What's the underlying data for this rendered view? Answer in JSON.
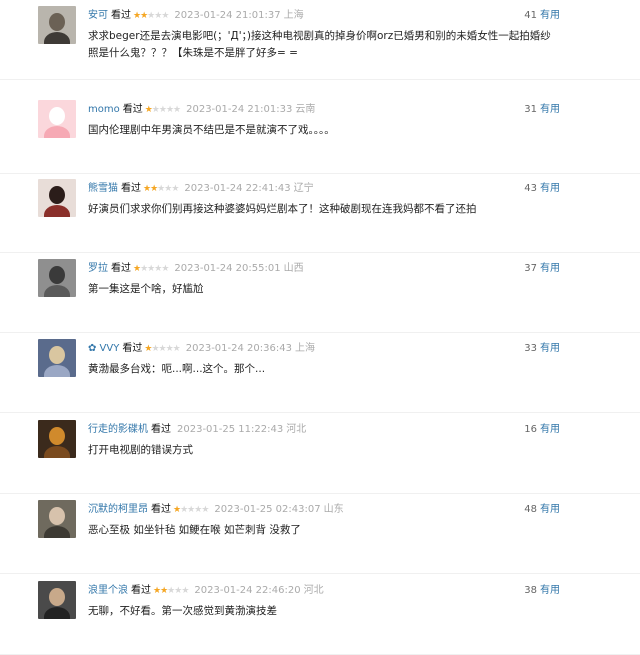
{
  "accent_colors": {
    "link": "#3377aa",
    "star_on": "#f5a623",
    "star_off": "#d8d8d8"
  },
  "reviews": [
    {
      "user": "安可",
      "status": "看过",
      "rating": 2,
      "time": "2023-01-24 21:01:37",
      "location": "上海",
      "useful_count": "41",
      "useful_label": "有用",
      "content": "求求beger还是去演电影吧(；'Д'；)接这种电视剧真的掉身价啊orz已婚男和别的未婚女性一起拍婚纱照是什么鬼？？？【朱珠是不是胖了好多= =",
      "avatar_colors": {
        "bg": "#b9b5ad",
        "head": "#6b6155",
        "body": "#3e3a36"
      }
    },
    {
      "user": "momo",
      "status": "看过",
      "rating": 1,
      "time": "2023-01-24 21:01:33",
      "location": "云南",
      "useful_count": "31",
      "useful_label": "有用",
      "content": "国内伦理剧中年男演员不结巴是不是就演不了戏。。。。",
      "avatar_colors": {
        "bg": "#fbd7dc",
        "head": "#ffffff",
        "body": "#f6a9b4"
      }
    },
    {
      "user": "熊雪猫",
      "status": "看过",
      "rating": 2,
      "time": "2023-01-24 22:41:43",
      "location": "辽宁",
      "useful_count": "43",
      "useful_label": "有用",
      "content": "好演员们求求你们别再接这种婆婆妈妈烂剧本了！这种破剧现在连我妈都不看了还拍",
      "avatar_colors": {
        "bg": "#e8ddd8",
        "head": "#2b1d1a",
        "body": "#8a2f2a"
      }
    },
    {
      "user": "罗拉",
      "status": "看过",
      "rating": 1,
      "time": "2023-01-24 20:55:01",
      "location": "山西",
      "useful_count": "37",
      "useful_label": "有用",
      "content": "第一集这是个啥，好尴尬",
      "avatar_colors": {
        "bg": "#8f8f8f",
        "head": "#3a3a3a",
        "body": "#5a5a5a"
      }
    },
    {
      "user": "✿ VVY",
      "status": "看过",
      "rating": 1,
      "time": "2023-01-24 20:36:43",
      "location": "上海",
      "useful_count": "33",
      "useful_label": "有用",
      "content": "黄渤最多台戏：呃...啊...这个。那个...",
      "avatar_colors": {
        "bg": "#5a6b8c",
        "head": "#d9c6a0",
        "body": "#9aa7c4"
      }
    },
    {
      "user": "行走的影碟机",
      "status": "看过",
      "rating": 0,
      "time": "2023-01-25 11:22:43",
      "location": "河北",
      "useful_count": "16",
      "useful_label": "有用",
      "content": "打开电视剧的错误方式",
      "avatar_colors": {
        "bg": "#3b2a1c",
        "head": "#d08a2c",
        "body": "#7a4a1e"
      }
    },
    {
      "user": "沉默的柯里昂",
      "status": "看过",
      "rating": 1,
      "time": "2023-01-25 02:43:07",
      "location": "山东",
      "useful_count": "48",
      "useful_label": "有用",
      "content": "恶心至极 如坐针毡 如鲠在喉 如芒刺背 没救了",
      "avatar_colors": {
        "bg": "#6f6a5e",
        "head": "#d7c2ac",
        "body": "#3d3a33"
      }
    },
    {
      "user": "浪里个浪",
      "status": "看过",
      "rating": 2,
      "time": "2023-01-24 22:46:20",
      "location": "河北",
      "useful_count": "38",
      "useful_label": "有用",
      "content": "无聊，不好看。第一次感觉到黄渤演技差",
      "avatar_colors": {
        "bg": "#4a4a4a",
        "head": "#c8a98a",
        "body": "#222222"
      }
    }
  ]
}
